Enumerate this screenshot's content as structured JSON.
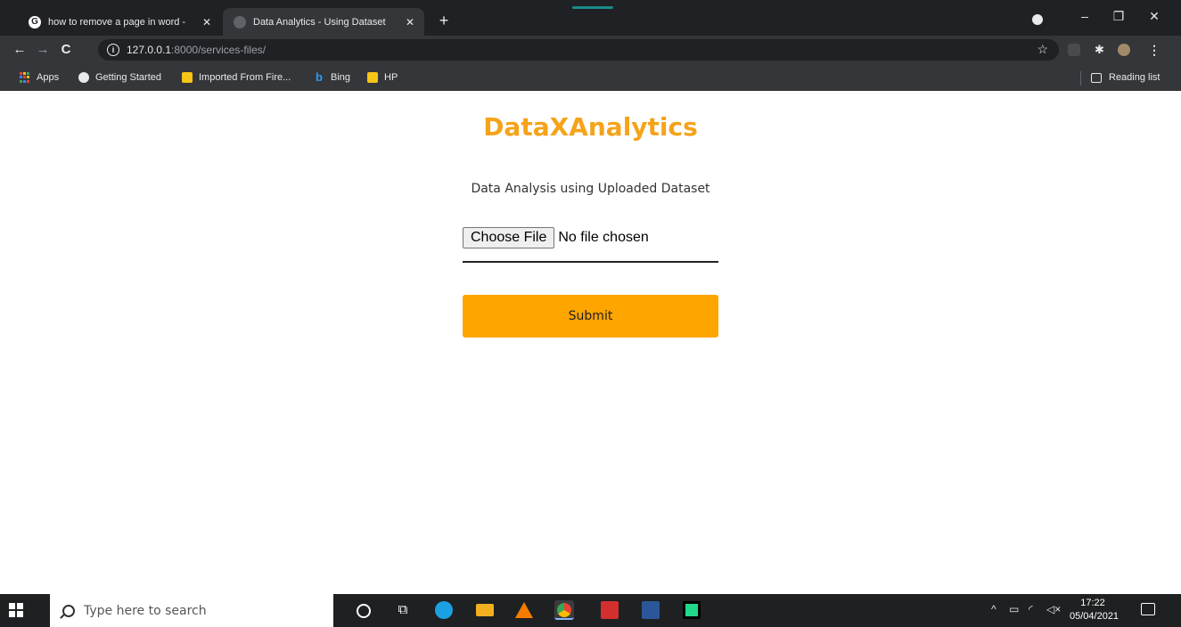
{
  "browser": {
    "tabs": [
      {
        "title": "how to remove a page in word -",
        "favicon": "google-icon",
        "active": false
      },
      {
        "title": "Data Analytics - Using Dataset",
        "favicon": "globe-icon",
        "active": true
      }
    ],
    "tab_close_glyph": "✕",
    "new_tab_glyph": "+",
    "window_controls": {
      "minimize": "–",
      "restore": "❐",
      "close": "✕"
    },
    "address": {
      "host": "127.0.0.1",
      "rest": ":8000/services-files/"
    },
    "bookmarks": [
      {
        "label": "Apps",
        "icon": "apps-grid-icon"
      },
      {
        "label": "Getting Started",
        "icon": "firefox-icon"
      },
      {
        "label": "Imported From Fire...",
        "icon": "folder-icon"
      },
      {
        "label": "Bing",
        "icon": "bing-icon"
      },
      {
        "label": "HP",
        "icon": "folder-icon"
      }
    ],
    "reading_list": "Reading list"
  },
  "page": {
    "brand": "DataXAnalytics",
    "subtitle": "Data Analysis using Uploaded Dataset",
    "file_input": {
      "button_label": "Choose File",
      "status": "No file chosen"
    },
    "submit_label": "Submit",
    "colors": {
      "brand": "#f5a31a",
      "submit_bg": "#ffa500"
    }
  },
  "taskbar": {
    "search_placeholder": "Type here to search",
    "time": "17:22",
    "date": "05/04/2021"
  }
}
